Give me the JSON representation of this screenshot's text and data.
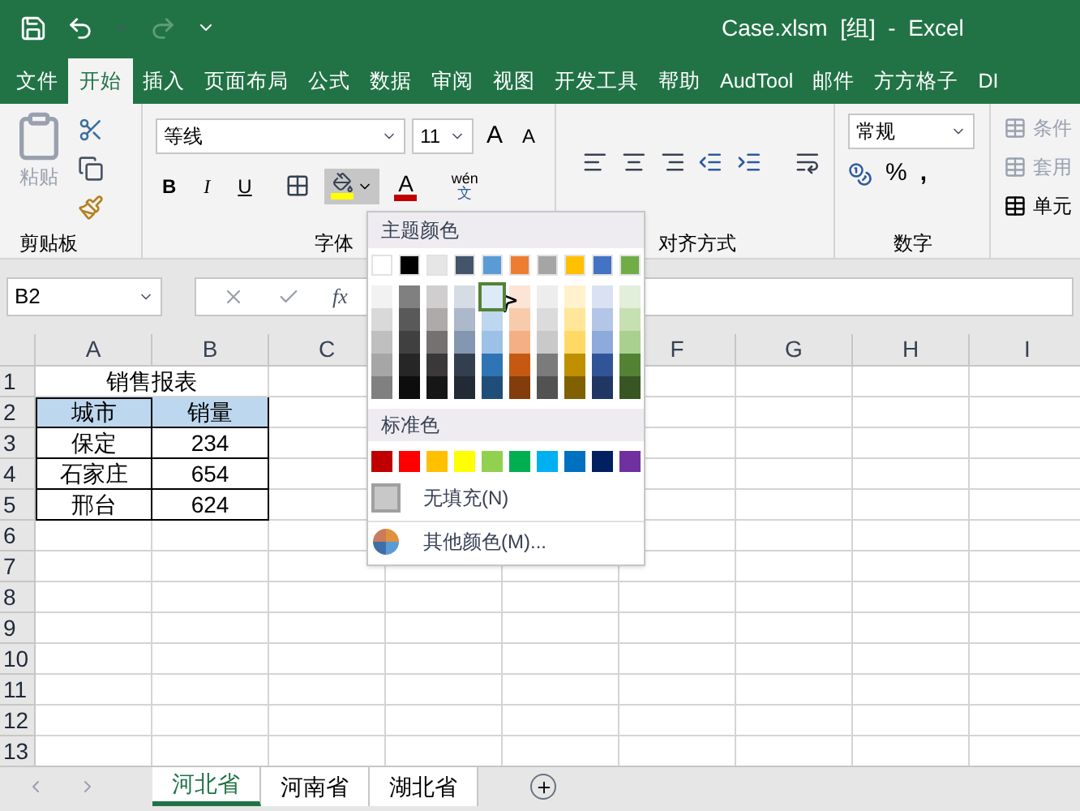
{
  "title_bar": {
    "title": "Case.xlsm  [组]  -  Excel"
  },
  "menu_tabs": [
    {
      "label": "文件",
      "selected": false
    },
    {
      "label": "开始",
      "selected": true
    },
    {
      "label": "插入",
      "selected": false
    },
    {
      "label": "页面布局",
      "selected": false
    },
    {
      "label": "公式",
      "selected": false
    },
    {
      "label": "数据",
      "selected": false
    },
    {
      "label": "审阅",
      "selected": false
    },
    {
      "label": "视图",
      "selected": false
    },
    {
      "label": "开发工具",
      "selected": false
    },
    {
      "label": "帮助",
      "selected": false
    },
    {
      "label": "AudTool",
      "selected": false
    },
    {
      "label": "邮件",
      "selected": false
    },
    {
      "label": "方方格子",
      "selected": false
    },
    {
      "label": "DI",
      "selected": false
    }
  ],
  "ribbon": {
    "clipboard": {
      "paste": "粘贴",
      "group_label": "剪贴板"
    },
    "font": {
      "font_name": "等线",
      "font_size": "11",
      "grow": "A",
      "shrink": "A",
      "bold": "B",
      "italic": "I",
      "underline": "U",
      "font_color": "A",
      "phonetic_top": "wén",
      "phonetic_bottom": "文",
      "group_label": "字体"
    },
    "alignment": {
      "group_label": "对齐方式"
    },
    "number": {
      "format": "常规",
      "percent": "%",
      "comma": ",",
      "group_label": "数字"
    },
    "styles": {
      "items": [
        "条件",
        "套用",
        "单元"
      ]
    }
  },
  "formula_bar": {
    "name_box": "B2",
    "fx": "fx"
  },
  "sheet": {
    "columns_left": [
      "A",
      "B",
      "C"
    ],
    "columns_right": [
      "F",
      "G",
      "H",
      "I"
    ],
    "rows": [
      "1",
      "2",
      "3",
      "4",
      "5",
      "6",
      "7",
      "8",
      "9",
      "10",
      "11",
      "12",
      "13"
    ],
    "title": "销售报表",
    "header": [
      "城市",
      "销量"
    ],
    "data": [
      [
        "保定",
        "234"
      ],
      [
        "石家庄",
        "654"
      ],
      [
        "邢台",
        "624"
      ]
    ]
  },
  "color_menu": {
    "theme_label": "主题颜色",
    "theme": [
      {
        "color": "#ffffff",
        "shades": [
          {
            "color": "#f2f2f2",
            "hovered": false
          },
          {
            "color": "#d9d9d9",
            "hovered": false
          },
          {
            "color": "#bfbfbf",
            "hovered": false
          },
          {
            "color": "#a6a6a6",
            "hovered": false
          },
          {
            "color": "#808080",
            "hovered": false
          }
        ]
      },
      {
        "color": "#000000",
        "shades": [
          {
            "color": "#808080",
            "hovered": false
          },
          {
            "color": "#595959",
            "hovered": false
          },
          {
            "color": "#404040",
            "hovered": false
          },
          {
            "color": "#262626",
            "hovered": false
          },
          {
            "color": "#0d0d0d",
            "hovered": false
          }
        ]
      },
      {
        "color": "#e7e6e6",
        "shades": [
          {
            "color": "#d0cece",
            "hovered": false
          },
          {
            "color": "#aeaaaa",
            "hovered": false
          },
          {
            "color": "#757171",
            "hovered": false
          },
          {
            "color": "#3a3838",
            "hovered": false
          },
          {
            "color": "#171616",
            "hovered": false
          }
        ]
      },
      {
        "color": "#44546a",
        "shades": [
          {
            "color": "#d6dce4",
            "hovered": false
          },
          {
            "color": "#acb9ca",
            "hovered": false
          },
          {
            "color": "#8497b0",
            "hovered": false
          },
          {
            "color": "#333f4f",
            "hovered": false
          },
          {
            "color": "#222b35",
            "hovered": false
          }
        ]
      },
      {
        "color": "#5b9bd5",
        "shades": [
          {
            "color": "#ddebf7",
            "hovered": true
          },
          {
            "color": "#bdd7ee",
            "hovered": false
          },
          {
            "color": "#9bc2e6",
            "hovered": false
          },
          {
            "color": "#2f75b5",
            "hovered": false
          },
          {
            "color": "#1f4e78",
            "hovered": false
          }
        ]
      },
      {
        "color": "#ed7d31",
        "shades": [
          {
            "color": "#fce4d6",
            "hovered": false
          },
          {
            "color": "#f8cbad",
            "hovered": false
          },
          {
            "color": "#f4b084",
            "hovered": false
          },
          {
            "color": "#c65911",
            "hovered": false
          },
          {
            "color": "#833c0c",
            "hovered": false
          }
        ]
      },
      {
        "color": "#a5a5a5",
        "shades": [
          {
            "color": "#ededed",
            "hovered": false
          },
          {
            "color": "#dbdbdb",
            "hovered": false
          },
          {
            "color": "#c9c9c9",
            "hovered": false
          },
          {
            "color": "#7b7b7b",
            "hovered": false
          },
          {
            "color": "#525252",
            "hovered": false
          }
        ]
      },
      {
        "color": "#ffc000",
        "shades": [
          {
            "color": "#fff2cc",
            "hovered": false
          },
          {
            "color": "#ffe699",
            "hovered": false
          },
          {
            "color": "#ffd966",
            "hovered": false
          },
          {
            "color": "#bf8f00",
            "hovered": false
          },
          {
            "color": "#806000",
            "hovered": false
          }
        ]
      },
      {
        "color": "#4472c4",
        "shades": [
          {
            "color": "#d9e1f2",
            "hovered": false
          },
          {
            "color": "#b4c6e7",
            "hovered": false
          },
          {
            "color": "#8ea9db",
            "hovered": false
          },
          {
            "color": "#305496",
            "hovered": false
          },
          {
            "color": "#203764",
            "hovered": false
          }
        ]
      },
      {
        "color": "#70ad47",
        "shades": [
          {
            "color": "#e2efda",
            "hovered": false
          },
          {
            "color": "#c6e0b4",
            "hovered": false
          },
          {
            "color": "#a9d08e",
            "hovered": false
          },
          {
            "color": "#548235",
            "hovered": false
          },
          {
            "color": "#375623",
            "hovered": false
          }
        ]
      }
    ],
    "standard_label": "标准色",
    "standard": [
      {
        "color": "#c00000"
      },
      {
        "color": "#ff0000"
      },
      {
        "color": "#ffc000"
      },
      {
        "color": "#ffff00"
      },
      {
        "color": "#92d050"
      },
      {
        "color": "#00b050"
      },
      {
        "color": "#00b0f0"
      },
      {
        "color": "#0070c0"
      },
      {
        "color": "#002060"
      },
      {
        "color": "#7030a0"
      }
    ],
    "no_fill": "无填充(N)",
    "more_colors": "其他颜色(M)..."
  },
  "sheet_tabs": [
    {
      "label": "河北省",
      "selected": true
    },
    {
      "label": "河南省",
      "selected": false
    },
    {
      "label": "湖北省",
      "selected": false
    }
  ]
}
